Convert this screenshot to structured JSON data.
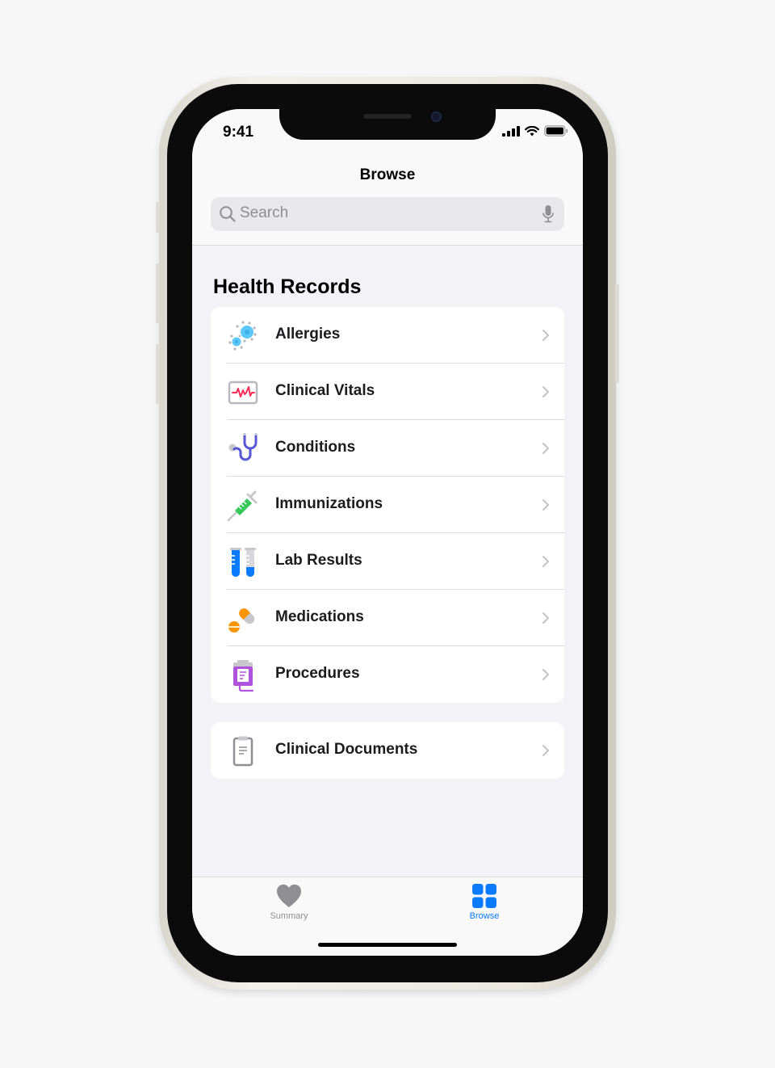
{
  "status_bar": {
    "time": "9:41"
  },
  "nav": {
    "title": "Browse"
  },
  "search": {
    "placeholder": "Search"
  },
  "section": {
    "title": "Health Records"
  },
  "records": [
    {
      "label": "Allergies",
      "icon": "allergies-icon"
    },
    {
      "label": "Clinical Vitals",
      "icon": "clinical-vitals-icon"
    },
    {
      "label": "Conditions",
      "icon": "stethoscope-icon"
    },
    {
      "label": "Immunizations",
      "icon": "syringe-icon"
    },
    {
      "label": "Lab Results",
      "icon": "test-tubes-icon"
    },
    {
      "label": "Medications",
      "icon": "pills-icon"
    },
    {
      "label": "Procedures",
      "icon": "iv-bag-icon"
    }
  ],
  "documents": {
    "label": "Clinical Documents",
    "icon": "clipboard-icon"
  },
  "tabbar": {
    "summary_label": "Summary",
    "browse_label": "Browse",
    "active": "Browse"
  },
  "colors": {
    "accent": "#0a7aff",
    "inactive": "#8e8e93",
    "background": "#f2f2f7"
  }
}
